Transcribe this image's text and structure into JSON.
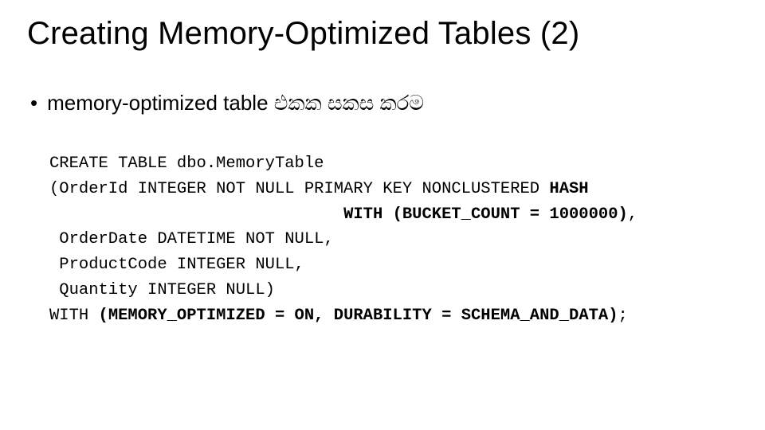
{
  "title": "Creating Memory-Optimized Tables (2)",
  "bullet": {
    "text": "memory-optimized table එකක    සකස    කරම"
  },
  "code": {
    "l1": "CREATE TABLE dbo.MemoryTable",
    "l2a": "(OrderId INTEGER NOT NULL PRIMARY KEY NONCLUSTERED ",
    "l2b": "HASH",
    "l3pad": "                              ",
    "l3b": "WITH (BUCKET_COUNT = 1000000)",
    "l3c": ",",
    "l4": " OrderDate DATETIME NOT NULL,",
    "l5": " ProductCode INTEGER NULL,",
    "l6": " Quantity INTEGER NULL)",
    "l7a": "WITH ",
    "l7b": "(MEMORY_OPTIMIZED = ON, DURABILITY = SCHEMA_AND_DATA)",
    "l7c": ";"
  }
}
